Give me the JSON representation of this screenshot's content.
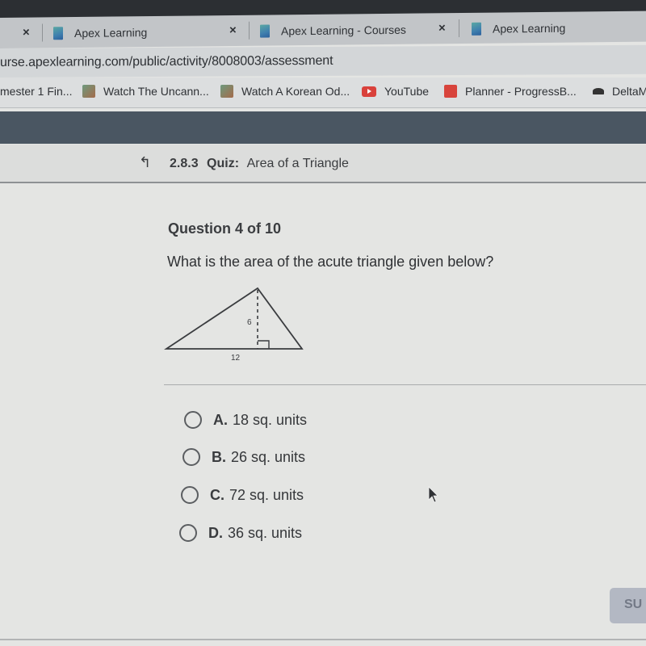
{
  "browser": {
    "tabs": [
      {
        "label": "Apex Learning",
        "close": "×"
      },
      {
        "label": "Apex Learning - Courses",
        "close": "×"
      },
      {
        "label": "Apex Learning",
        "close": "×"
      }
    ],
    "leading_close": "×",
    "url": "urse.apexlearning.com/public/activity/8008003/assessment",
    "bookmarks": [
      {
        "label": "mester 1 Fin...",
        "icon": "none"
      },
      {
        "label": "Watch The Uncann...",
        "icon": "video-thumbnail-icon"
      },
      {
        "label": "Watch A Korean Od...",
        "icon": "video-thumbnail-icon"
      },
      {
        "label": "YouTube",
        "icon": "youtube-icon"
      },
      {
        "label": "Planner - ProgressB...",
        "icon": "planner-icon"
      },
      {
        "label": "DeltaM",
        "icon": "delta-icon"
      }
    ]
  },
  "quiz": {
    "back_icon": "↰",
    "number": "2.8.3",
    "type_label": "Quiz:",
    "title": "Area of a Triangle"
  },
  "question": {
    "counter": "Question 4 of 10",
    "text": "What is the area of the acute triangle given below?",
    "figure": {
      "shape": "acute triangle",
      "height_label": "6",
      "base_label": "12"
    },
    "options": [
      {
        "letter": "A.",
        "text": "18 sq. units",
        "selected": false
      },
      {
        "letter": "B.",
        "text": "26 sq. units",
        "selected": false
      },
      {
        "letter": "C.",
        "text": "72 sq. units",
        "selected": false
      },
      {
        "letter": "D.",
        "text": "36 sq. units",
        "selected": false
      }
    ]
  },
  "submit_label": "SU"
}
